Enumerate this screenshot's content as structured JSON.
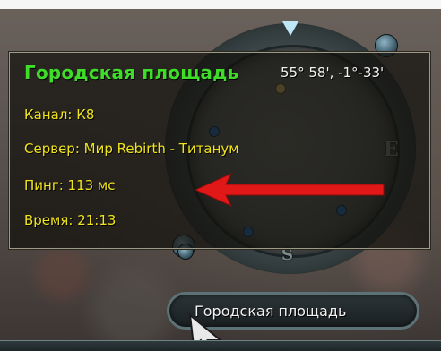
{
  "tooltip": {
    "title": "Городская площадь",
    "coords": "55° 58', -1°-33'",
    "lines": [
      "Канал: К8",
      "Сервер: Мир Rebirth - Титанум",
      "Пинг: 113 мс",
      "Время: 21:13"
    ]
  },
  "minimap": {
    "letters": {
      "east": "E",
      "south": "S"
    }
  },
  "location_label": "Городская площадь",
  "colors": {
    "title_green": "#3fdc2a",
    "info_yellow": "#f0e41e",
    "arrow_red": "#e01818"
  },
  "icons": {
    "arrow": "red-arrow-icon",
    "cursor": "mouse-cursor-icon",
    "north": "north-marker-icon"
  }
}
